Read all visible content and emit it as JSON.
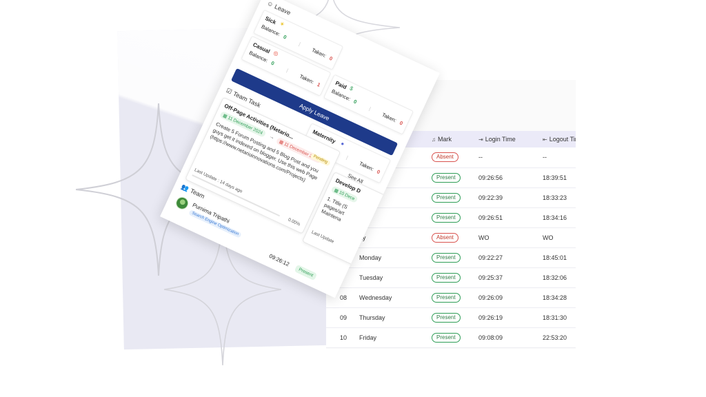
{
  "attendance": {
    "headers": {
      "mark": "Mark",
      "login": "Login Time",
      "logout": "Logout Tim"
    },
    "rows": [
      {
        "day": "",
        "name": "",
        "mark": "Absent",
        "status": "absent",
        "login": "--",
        "logout": "--"
      },
      {
        "day": "",
        "name": "",
        "mark": "Present",
        "status": "present",
        "login": "09:26:56",
        "logout": "18:39:51"
      },
      {
        "day": "",
        "name": "",
        "mark": "Present",
        "status": "present",
        "login": "09:22:39",
        "logout": "18:33:23"
      },
      {
        "day": "",
        "name": "",
        "mark": "Present",
        "status": "present",
        "login": "09:26:51",
        "logout": "18:34:16"
      },
      {
        "day": "",
        "name": "ay",
        "mark": "Absent",
        "status": "absent",
        "login": "WO",
        "logout": "WO"
      },
      {
        "day": "",
        "name": "Monday",
        "mark": "Present",
        "status": "present",
        "login": "09:22:27",
        "logout": "18:45:01"
      },
      {
        "day": "",
        "name": "Tuesday",
        "mark": "Present",
        "status": "present",
        "login": "09:25:37",
        "logout": "18:32:06"
      },
      {
        "day": "08",
        "name": "Wednesday",
        "mark": "Present",
        "status": "present",
        "login": "09:26:09",
        "logout": "18:34:28"
      },
      {
        "day": "09",
        "name": "Thursday",
        "mark": "Present",
        "status": "present",
        "login": "09:26:19",
        "logout": "18:31:30"
      },
      {
        "day": "10",
        "name": "Friday",
        "mark": "Present",
        "status": "present",
        "login": "09:08:09",
        "logout": "22:53:20"
      }
    ],
    "partial_row_number": "10"
  },
  "leave": {
    "title": "Leave",
    "balance_label": "Balance:",
    "taken_label": "Taken:",
    "types": [
      {
        "name": "Sick",
        "balance": "0",
        "taken": "0"
      },
      {
        "name": "Casual",
        "balance": "0",
        "taken": "1"
      },
      {
        "name": "Paid",
        "balance": "0",
        "taken": "0"
      },
      {
        "name": "Maternity",
        "balance": "0",
        "taken": "0"
      }
    ],
    "apply_label": "Apply Leave"
  },
  "team_task": {
    "title": "Team Task",
    "see_all": "See All",
    "task1": {
      "title": "Off-Page Activities (Netario...",
      "start": "11 December 2024",
      "end": "11 December 2024",
      "status": "Pending",
      "description": "Create 5 Forum Posting and 5 Blog Post and you guys get it indexed on blogger. Use this web Page (https://www.netarioinnovations.com/Projects)",
      "last_update": "Last Update : 14 days ago",
      "progress_label": "0.00%",
      "progress": 0
    },
    "task2": {
      "title": "Develop D",
      "start": "10 Dece",
      "description": "1. Title (S pages/art Maintena",
      "last_update": "Last Update"
    }
  },
  "team": {
    "title": "Team",
    "member": {
      "name": "Purnima Tripathi",
      "role": "Search Engine Optimization",
      "time": "09:26:12",
      "status": "Present"
    }
  },
  "colors": {
    "primary": "#1e3a8a",
    "present": "#2e9d56",
    "absent": "#d9534f",
    "header_bg": "#ebeaf8",
    "backdrop": "#e9e9f3"
  }
}
